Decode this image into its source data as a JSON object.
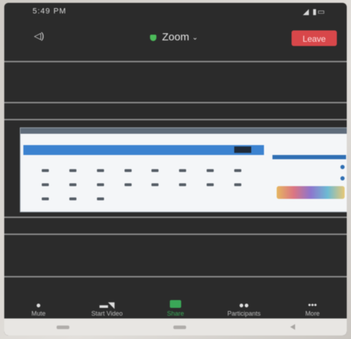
{
  "status_bar": {
    "time": "5:49 PM",
    "indicators": "◢ ▮▭"
  },
  "meeting": {
    "title": "Zoom",
    "title_icon": "shield-icon",
    "caret": "⌄",
    "leave_label": "Leave",
    "leave_color": "#d8474a",
    "speaker_icon": "speaker-icon"
  },
  "toolbar": {
    "items": [
      {
        "label": "Mute",
        "icon": "microphone-icon"
      },
      {
        "label": "Start Video",
        "icon": "video-camera-icon"
      },
      {
        "label": "Share",
        "icon": "share-screen-icon"
      },
      {
        "label": "Participants",
        "icon": "participants-icon"
      },
      {
        "label": "More",
        "icon": "more-icon"
      }
    ]
  },
  "colors": {
    "share_accent": "#3aa757",
    "bg": "#2b2b2b"
  }
}
